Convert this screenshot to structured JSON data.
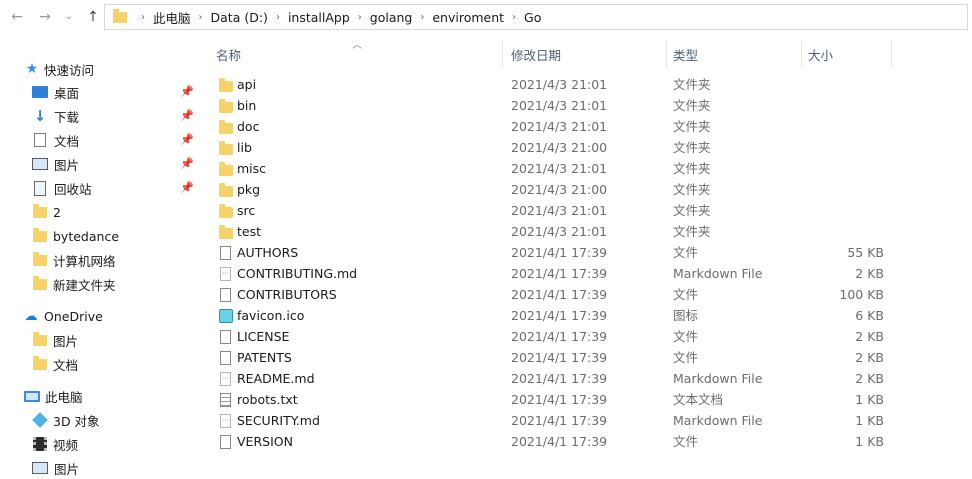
{
  "breadcrumb": [
    "此电脑",
    "Data (D:)",
    "installApp",
    "golang",
    "enviroment",
    "Go"
  ],
  "columns": {
    "name": "名称",
    "date": "修改日期",
    "type": "类型",
    "size": "大小"
  },
  "sidebar": {
    "quick_access": "快速访问",
    "desktop": "桌面",
    "downloads": "下载",
    "documents": "文档",
    "pictures": "图片",
    "recycle": "回收站",
    "folder_2": "2",
    "bytedance": "bytedance",
    "network": "计算机网络",
    "new_folder": "新建文件夹",
    "onedrive": "OneDrive",
    "od_pictures": "图片",
    "od_documents": "文档",
    "this_pc": "此电脑",
    "objects_3d": "3D 对象",
    "videos": "视频",
    "pc_pictures": "图片"
  },
  "files": [
    {
      "name": "api",
      "date": "2021/4/3 21:01",
      "type": "文件夹",
      "size": "",
      "icon": "folder"
    },
    {
      "name": "bin",
      "date": "2021/4/3 21:01",
      "type": "文件夹",
      "size": "",
      "icon": "folder"
    },
    {
      "name": "doc",
      "date": "2021/4/3 21:01",
      "type": "文件夹",
      "size": "",
      "icon": "folder"
    },
    {
      "name": "lib",
      "date": "2021/4/3 21:00",
      "type": "文件夹",
      "size": "",
      "icon": "folder"
    },
    {
      "name": "misc",
      "date": "2021/4/3 21:01",
      "type": "文件夹",
      "size": "",
      "icon": "folder"
    },
    {
      "name": "pkg",
      "date": "2021/4/3 21:00",
      "type": "文件夹",
      "size": "",
      "icon": "folder"
    },
    {
      "name": "src",
      "date": "2021/4/3 21:01",
      "type": "文件夹",
      "size": "",
      "icon": "folder"
    },
    {
      "name": "test",
      "date": "2021/4/3 21:01",
      "type": "文件夹",
      "size": "",
      "icon": "folder"
    },
    {
      "name": "AUTHORS",
      "date": "2021/4/1 17:39",
      "type": "文件",
      "size": "55 KB",
      "icon": "file"
    },
    {
      "name": "CONTRIBUTING.md",
      "date": "2021/4/1 17:39",
      "type": "Markdown File",
      "size": "2 KB",
      "icon": "markdown"
    },
    {
      "name": "CONTRIBUTORS",
      "date": "2021/4/1 17:39",
      "type": "文件",
      "size": "100 KB",
      "icon": "file"
    },
    {
      "name": "favicon.ico",
      "date": "2021/4/1 17:39",
      "type": "图标",
      "size": "6 KB",
      "icon": "image"
    },
    {
      "name": "LICENSE",
      "date": "2021/4/1 17:39",
      "type": "文件",
      "size": "2 KB",
      "icon": "file"
    },
    {
      "name": "PATENTS",
      "date": "2021/4/1 17:39",
      "type": "文件",
      "size": "2 KB",
      "icon": "file"
    },
    {
      "name": "README.md",
      "date": "2021/4/1 17:39",
      "type": "Markdown File",
      "size": "2 KB",
      "icon": "markdown"
    },
    {
      "name": "robots.txt",
      "date": "2021/4/1 17:39",
      "type": "文本文档",
      "size": "1 KB",
      "icon": "text"
    },
    {
      "name": "SECURITY.md",
      "date": "2021/4/1 17:39",
      "type": "Markdown File",
      "size": "1 KB",
      "icon": "markdown"
    },
    {
      "name": "VERSION",
      "date": "2021/4/1 17:39",
      "type": "文件",
      "size": "1 KB",
      "icon": "file"
    }
  ]
}
